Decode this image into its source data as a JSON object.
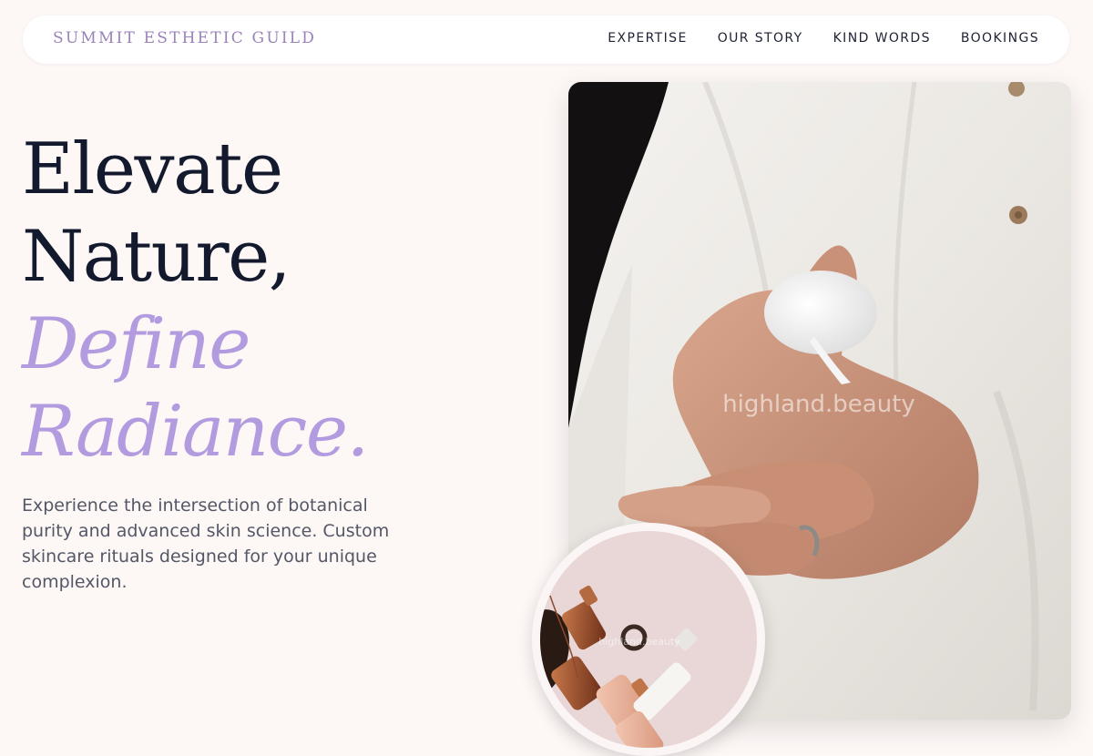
{
  "brand": "SUMMIT ESTHETIC GUILD",
  "nav": {
    "items": [
      "EXPERTISE",
      "OUR STORY",
      "KIND WORDS",
      "BOOKINGS"
    ]
  },
  "hero": {
    "line1": "Elevate",
    "line2": "Nature,",
    "line3": "Define",
    "line4": "Radiance.",
    "description": "Experience the intersection of botanical purity and advanced skin science. Custom skincare rituals designed for your unique complexion."
  },
  "images": {
    "main_watermark": "highland.beauty",
    "circle_watermark": "highland.beauty"
  },
  "colors": {
    "background": "#fdf7f6",
    "brand": "#9b82ba",
    "accent": "#b39be0",
    "heading": "#141a2e",
    "body_text": "#535766"
  }
}
